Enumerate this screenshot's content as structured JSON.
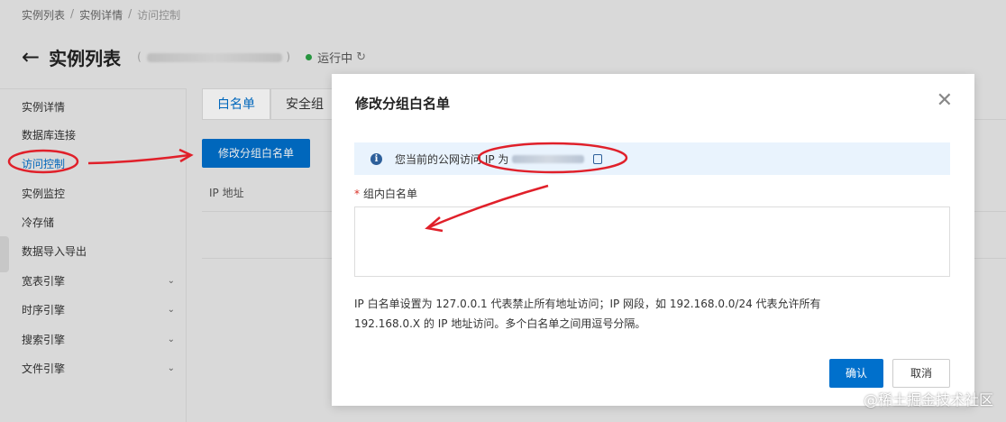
{
  "breadcrumb": {
    "items": [
      "实例列表",
      "实例详情",
      "访问控制"
    ],
    "separator": "/"
  },
  "header": {
    "title": "实例列表",
    "status": "运行中",
    "back_icon": "arrow-left-icon",
    "refresh_icon": "refresh-icon"
  },
  "sidebar": {
    "items": [
      {
        "label": "实例详情"
      },
      {
        "label": "数据库连接"
      },
      {
        "label": "访问控制"
      },
      {
        "label": "实例监控"
      },
      {
        "label": "冷存储"
      },
      {
        "label": "数据导入导出"
      },
      {
        "label": "宽表引擎"
      },
      {
        "label": "时序引擎"
      },
      {
        "label": "搜索引擎"
      },
      {
        "label": "文件引擎"
      }
    ]
  },
  "tabs": [
    {
      "label": "白名单"
    },
    {
      "label": "安全组"
    }
  ],
  "main": {
    "modify_button": "修改分组白名单",
    "column_ip": "IP 地址"
  },
  "modal": {
    "title": "修改分组白名单",
    "info_prefix": "您当前的公网访问 IP 为",
    "field_label": "组内白名单",
    "textarea_value": "",
    "help_line1": "IP 白名单设置为 127.0.0.1 代表禁止所有地址访问；IP 网段，如 192.168.0.0/24 代表允许所有",
    "help_line2": "192.168.0.X 的 IP 地址访问。多个白名单之间用逗号分隔。",
    "confirm": "确认",
    "cancel": "取消"
  },
  "watermark": "@稀土掘金技术社区",
  "colors": {
    "primary": "#0070cc",
    "status_green": "#2ba245",
    "annotation_red": "#e0202a",
    "info_bg": "#e9f3fd"
  }
}
